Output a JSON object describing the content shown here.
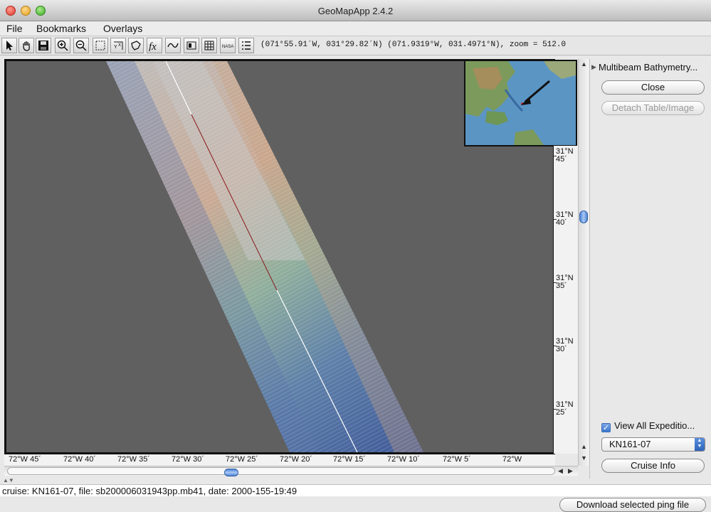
{
  "window": {
    "title": "GeoMapApp 2.4.2"
  },
  "menu": {
    "items": [
      "File",
      "Bookmarks",
      "Overlays"
    ]
  },
  "toolbar": {
    "tools": [
      "select-arrow-icon",
      "pan-hand-icon",
      "save-icon",
      "zoom-in-icon",
      "zoom-out-icon",
      "marquee-select-icon",
      "xyz-icon",
      "lasso-icon",
      "function-fx-icon",
      "profile-icon",
      "layout-icon",
      "grid-icon",
      "nasa-icon",
      "graticule-icon",
      "list-icon"
    ],
    "coordinates": "(071°55.91´W, 031°29.82´N) (071.9319°W, 031.4971°N), zoom = 512.0"
  },
  "map": {
    "lat_labels": [
      {
        "deg": "31°N",
        "min": "45´"
      },
      {
        "deg": "31°N",
        "min": "40´"
      },
      {
        "deg": "31°N",
        "min": "35´"
      },
      {
        "deg": "31°N",
        "min": "30´"
      },
      {
        "deg": "31°N",
        "min": "25´"
      }
    ],
    "lon_labels": [
      "72°W 45´",
      "72°W 40´",
      "72°W 35´",
      "72°W 30´",
      "72°W 25´",
      "72°W 20´",
      "72°W 15´",
      "72°W 10´",
      "72°W 5´",
      "72°W"
    ]
  },
  "panel": {
    "title": "Multibeam Bathymetry...",
    "close_label": "Close",
    "detach_label": "Detach Table/Image",
    "view_all_label": "View All Expeditio...",
    "view_all_checked": true,
    "cruise_selected": "KN161-07",
    "cruise_info_label": "Cruise Info"
  },
  "status": {
    "text": "cruise: KN161-07, file: sb200006031943pp.mb41, date: 2000-155-19:49"
  },
  "download_label": "Download selected ping file"
}
